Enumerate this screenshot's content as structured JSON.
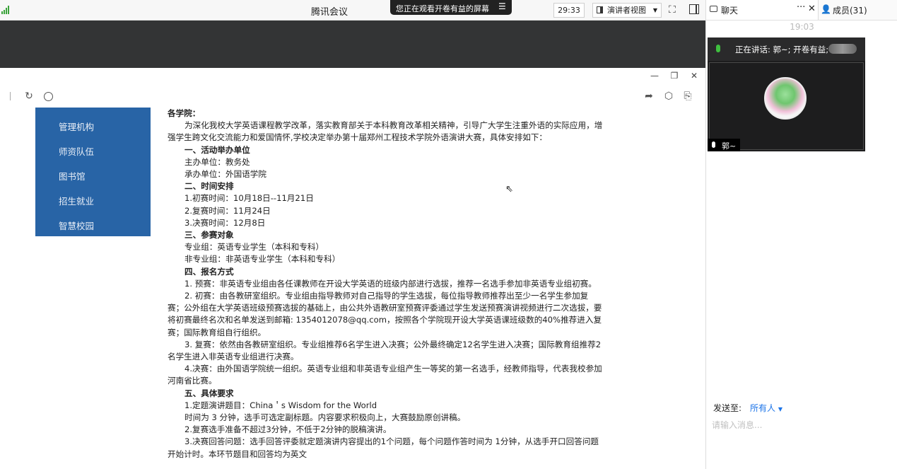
{
  "titlebar": {
    "app_title": "腾讯会议",
    "share_banner": "您正在观看开卷有益的屏幕",
    "share_menu_icon": "menu-icon",
    "timer": "29:33",
    "view_mode": "演讲者视图",
    "signal_color": "#3aa33a"
  },
  "nav": {
    "items": [
      "管理机构",
      "师资队伍",
      "图书馆",
      "招生就业",
      "智慧校园"
    ],
    "bg_color": "#2864a6"
  },
  "article": {
    "greeting": "各学院：",
    "intro": "为深化我校大学英语课程教学改革，落实教育部关于本科教育改革相关精神，引导广大学生注重外语的实际应用，增强学生跨文化交流能力和爱国情怀,学校决定举办第十届郑州工程技术学院外语演讲大赛，具体安排如下：",
    "s1_title": "一、活动举办单位",
    "s1_a": "主办单位：教务处",
    "s1_b": "承办单位：外国语学院",
    "s2_title": "二、时间安排",
    "s2_a": "1.初赛时间：10月18日--11月21日",
    "s2_b": "2.复赛时间：11月24日",
    "s2_c": "3.决赛时间：12月8日",
    "s3_title": "三、参赛对象",
    "s3_a": "专业组：英语专业学生（本科和专科）",
    "s3_b": "非专业组：非英语专业学生（本科和专科）",
    "s4_title": "四、报名方式",
    "s4_p1": "1. 预赛：非英语专业组由各任课教师在开设大学英语的班级内部进行选拔，推荐一名选手参加非英语专业组初赛。",
    "s4_p2": "2. 初赛：由各教研室组织。专业组由指导教师对自己指导的学生选拔，每位指导教师推荐出至少一名学生参加复赛；公外组在大学英语班级预赛选拔的基础上，由公共外语教研室预赛评委通过学生发送预赛演讲视频进行二次选拔，要将初赛最终名次和名单发送到邮箱: 1354012078@qq.com，按照各个学院现开设大学英语课班级数的40%推荐进入复赛；国际教育组自行组织。",
    "s4_p3": "3. 复赛：依然由各教研室组织。专业组推荐6名学生进入决赛；公外最终确定12名学生进入决赛；国际教育组推荐2名学生进入非英语专业组进行决赛。",
    "s4_p4": "4.决赛：由外国语学院统一组织。英语专业组和非英语专业组产生一等奖的第一名选手，经教师指导，代表我校参加河南省比赛。",
    "s5_title": "五、具体要求",
    "s5_a": "1.定题演讲题目：China＇s Wisdom for the World",
    "s5_b": "时间为 3 分钟，选手可选定副标题。内容要求积极向上，大赛鼓励原创讲稿。",
    "s5_c": "2.复赛选手准备不超过3分钟，不低于2分钟的脱稿演讲。",
    "s5_d": "3.决赛回答问题：选手回答评委就定题演讲内容提出的1个问题，每个问题作答时间为 1分钟，从选手开口回答问题开始计时。本环节题目和回答均为英文"
  },
  "chat": {
    "tab_label": "聊天",
    "more": "···",
    "close": "✕",
    "members_label": "成员(31)",
    "time": "19:03",
    "speaking_text": "正在讲话: 郭~; 开卷有益;",
    "participant_name": "郭~",
    "send_to_label": "发送至:",
    "send_to_target": "所有人",
    "input_placeholder": "请输入消息...",
    "input_value": "",
    "accent_color": "#1a73e8"
  }
}
